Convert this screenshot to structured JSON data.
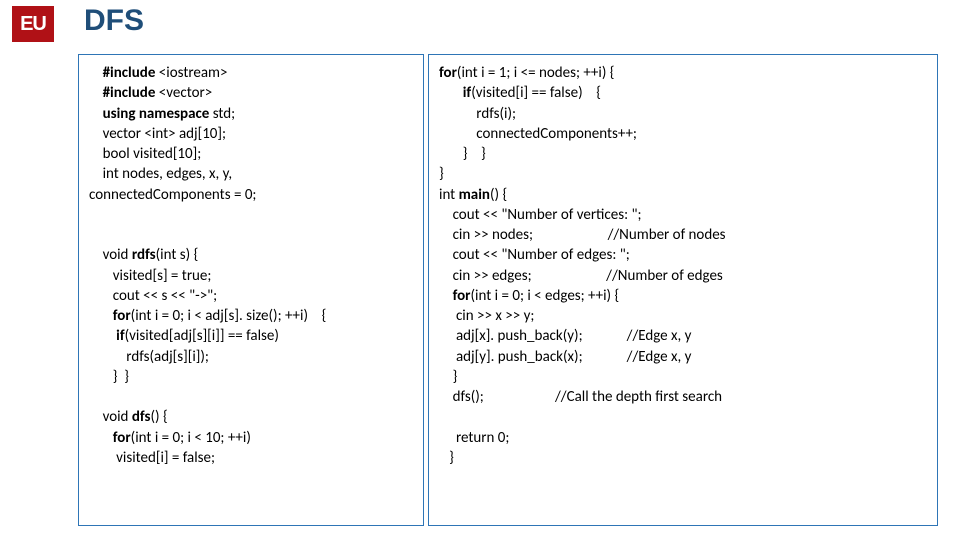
{
  "logo": "EU",
  "title": "DFS",
  "left_code": "    <b>#include</b> &lt;iostream&gt;\n    <b>#include</b> &lt;vector&gt;\n    <b>using namespace</b> std;\n    vector &lt;int&gt; adj[10];\n    bool visited[10];\n    int nodes, edges, x, y,\nconnectedComponents = 0;\n\n\n    void <b>rdfs</b>(int s) {\n       visited[s] = true;\n       cout &lt;&lt; s &lt;&lt; \"-&gt;\";\n       <b>for</b>(int i = 0; i &lt; adj[s]. size(); ++i)    {\n        <b>if</b>(visited[adj[s][i]] == false)\n           rdfs(adj[s][i]);\n       }  }\n\n    void <b>dfs</b>() {\n       <b>for</b>(int i = 0; i &lt; 10; ++i)\n        visited[i] = false;",
  "right_code": "<b>for</b>(int i = 1; i &lt;= nodes; ++i) {\n       <b>if</b>(visited[i] == false)    {\n           rdfs(i);\n           connectedComponents++;\n       }    }\n}\nint <b>main</b>() {\n    cout &lt;&lt; \"Number of vertices: \";\n    cin &gt;&gt; nodes;                      //Number of nodes\n    cout &lt;&lt; \"Number of edges: \";\n    cin &gt;&gt; edges;                      //Number of edges\n    <b>for</b>(int i = 0; i &lt; edges; ++i) {\n     cin &gt;&gt; x &gt;&gt; y;\n     adj[x]. push_back(y);             //Edge x, y\n     adj[y]. push_back(x);             //Edge x, y\n    }\n    dfs();                     //Call the depth first search\n\n     return 0;\n   }"
}
